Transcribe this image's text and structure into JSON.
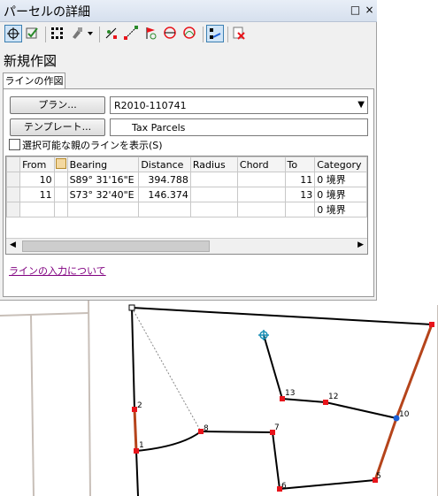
{
  "window": {
    "title": "パーセルの詳細"
  },
  "heading": "新規作図",
  "tab_label": "ラインの作図",
  "plan": {
    "button_label": "プラン...",
    "value": "R2010-110741"
  },
  "template": {
    "button_label": "テンプレート...",
    "value": "Tax Parcels"
  },
  "show_parent_lines": {
    "label": "選択可能な親のラインを表示(S)",
    "checked": false
  },
  "table": {
    "columns": [
      "From",
      "",
      "Bearing",
      "Distance",
      "Radius",
      "Chord",
      "To",
      "Category"
    ],
    "rows": [
      {
        "from": "10",
        "bearing": "S89° 31'16\"E",
        "distance": "394.788",
        "radius": "",
        "chord": "",
        "to": "11",
        "category": "0 境界"
      },
      {
        "from": "11",
        "bearing": "S73° 32'40\"E",
        "distance": "146.374",
        "radius": "",
        "chord": "",
        "to": "13",
        "category": "0 境界"
      },
      {
        "from": "",
        "bearing": "",
        "distance": "",
        "radius": "",
        "chord": "",
        "to": "",
        "category": "0 境界"
      }
    ]
  },
  "help_link": "ラインの入力について",
  "map_labels": {
    "p1": "1",
    "p2": "2",
    "p5": "5",
    "p6": "6",
    "p7": "7",
    "p8": "8",
    "p10": "10",
    "p12": "12",
    "p13": "13"
  },
  "colors": {
    "boundary_highlight": "#b5441b",
    "point": "#e8141b",
    "selected_point": "#1a5fd6",
    "line": "#000000"
  }
}
